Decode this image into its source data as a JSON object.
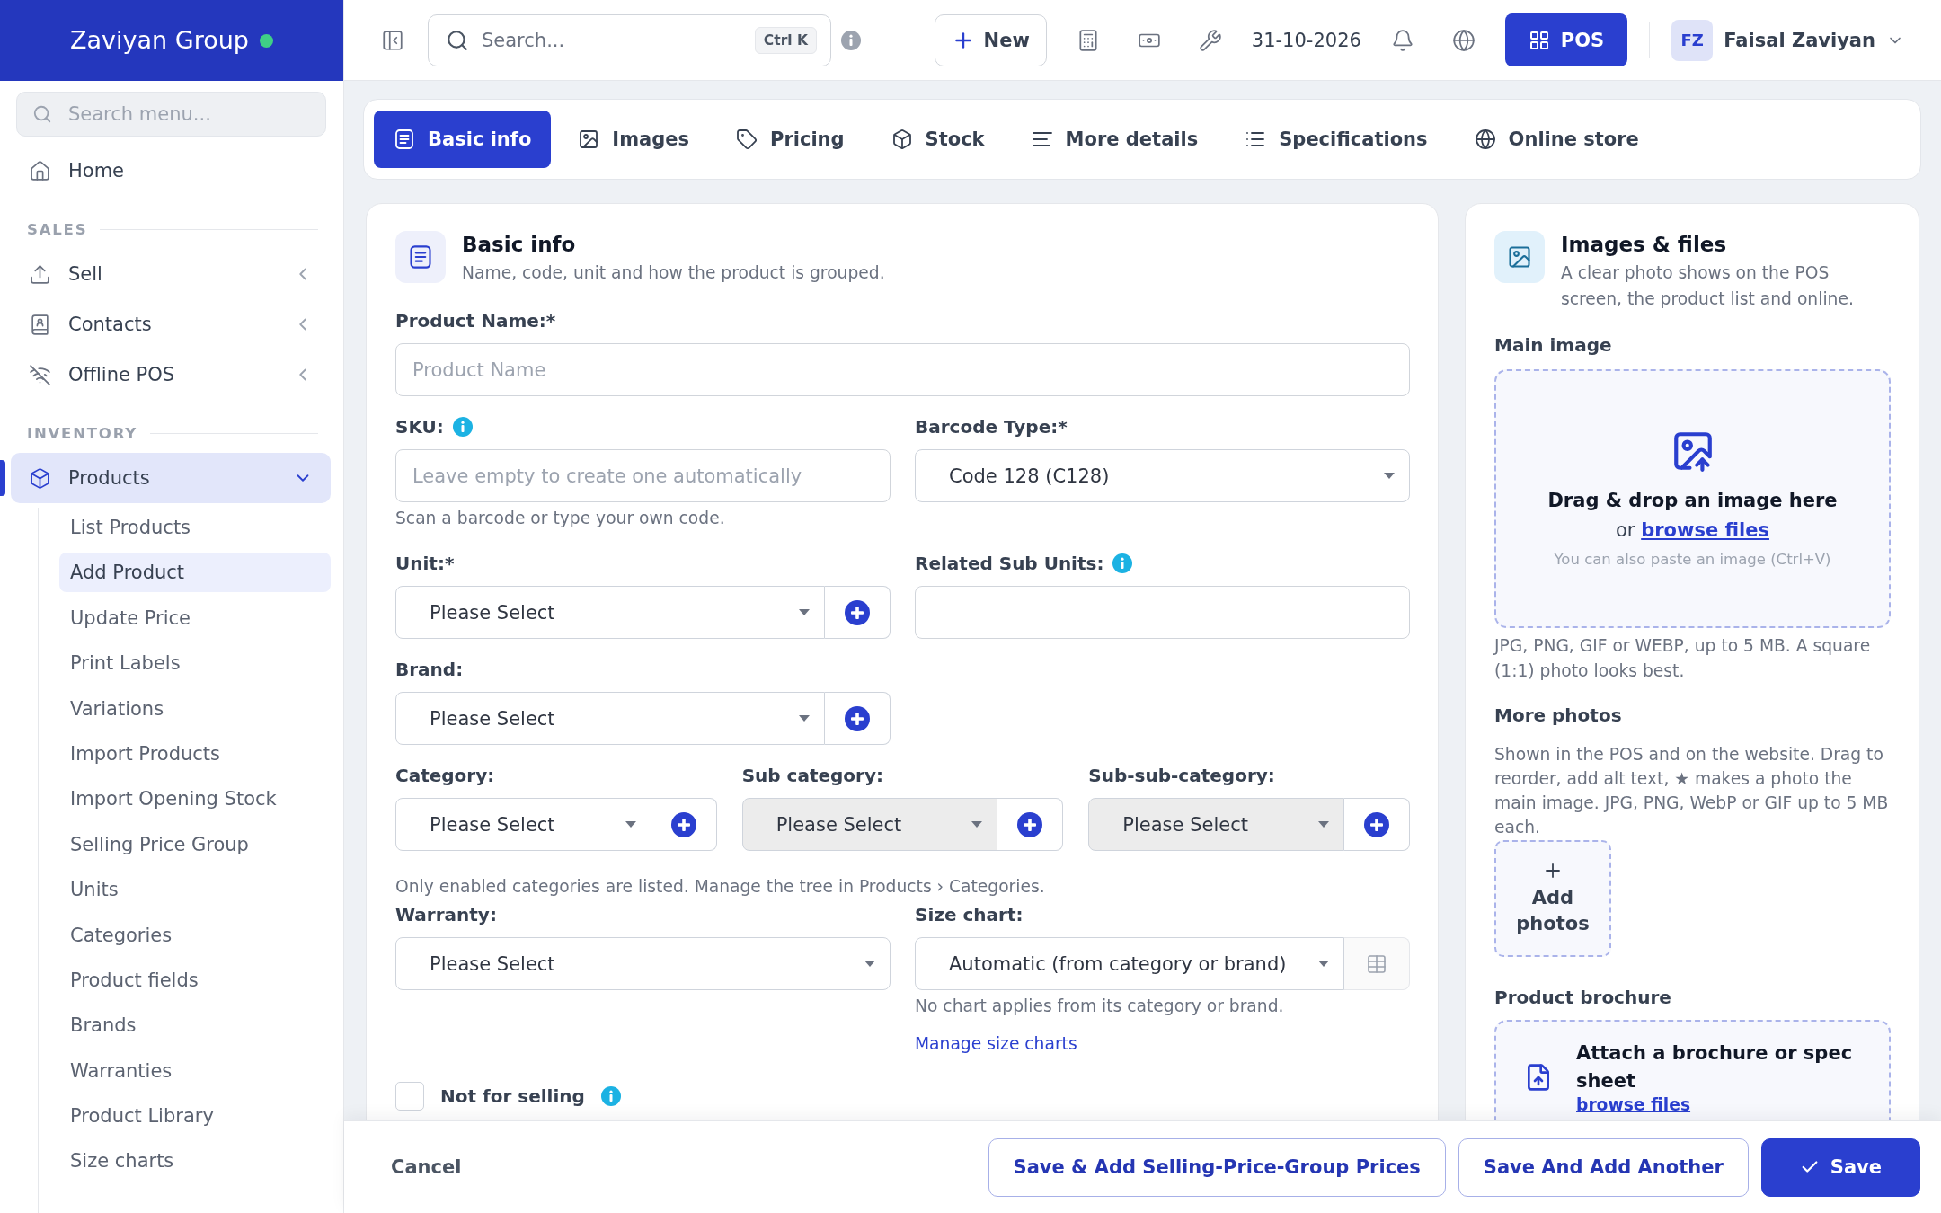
{
  "brand": {
    "name": "Zaviyan Group",
    "online": true
  },
  "topbar": {
    "search": {
      "placeholder": "Search...",
      "shortcut": "Ctrl K"
    },
    "new_button": "New",
    "date": "31-10-2026",
    "pos_button": "POS",
    "user": {
      "initials": "FZ",
      "name": "Faisal Zaviyan"
    }
  },
  "sidebar": {
    "search": {
      "placeholder": "Search menu..."
    },
    "items": [
      {
        "kind": "link",
        "label": "Home",
        "selected": false
      },
      {
        "kind": "heading",
        "label": "SALES"
      },
      {
        "kind": "group",
        "label": "Sell",
        "selected": false,
        "expanded": false
      },
      {
        "kind": "group",
        "label": "Contacts",
        "selected": false,
        "expanded": false
      },
      {
        "kind": "group",
        "label": "Offline POS",
        "selected": false,
        "expanded": false
      },
      {
        "kind": "heading",
        "label": "INVENTORY"
      },
      {
        "kind": "group",
        "label": "Products",
        "selected": true,
        "expanded": true,
        "children": [
          {
            "label": "List Products",
            "selected": false
          },
          {
            "label": "Add Product",
            "selected": true
          },
          {
            "label": "Update Price",
            "selected": false
          },
          {
            "label": "Print Labels",
            "selected": false
          },
          {
            "label": "Variations",
            "selected": false
          },
          {
            "label": "Import Products",
            "selected": false
          },
          {
            "label": "Import Opening Stock",
            "selected": false
          },
          {
            "label": "Selling Price Group",
            "selected": false
          },
          {
            "label": "Units",
            "selected": false
          },
          {
            "label": "Categories",
            "selected": false
          },
          {
            "label": "Product fields",
            "selected": false
          },
          {
            "label": "Brands",
            "selected": false
          },
          {
            "label": "Warranties",
            "selected": false
          },
          {
            "label": "Product Library",
            "selected": false
          },
          {
            "label": "Size charts",
            "selected": false
          }
        ]
      }
    ]
  },
  "tabs": [
    {
      "label": "Basic info",
      "selected": true
    },
    {
      "label": "Images",
      "selected": false
    },
    {
      "label": "Pricing",
      "selected": false
    },
    {
      "label": "Stock",
      "selected": false
    },
    {
      "label": "More details",
      "selected": false
    },
    {
      "label": "Specifications",
      "selected": false
    },
    {
      "label": "Online store",
      "selected": false
    }
  ],
  "basic_info": {
    "title": "Basic info",
    "subtitle": "Name, code, unit and how the product is grouped.",
    "product_name": {
      "label": "Product Name:*",
      "placeholder": "Product Name"
    },
    "sku": {
      "label": "SKU:",
      "info": true,
      "placeholder": "Leave empty to create one automatically",
      "hint": "Scan a barcode or type your own code."
    },
    "barcode_type": {
      "label": "Barcode Type:*",
      "value": "Code 128 (C128)"
    },
    "unit": {
      "label": "Unit:*",
      "value": "Please Select"
    },
    "related_sub_units": {
      "label": "Related Sub Units:",
      "info": true
    },
    "brand": {
      "label": "Brand:",
      "value": "Please Select"
    },
    "categories": [
      {
        "label": "Category:",
        "value": "Please Select",
        "disabled": false
      },
      {
        "label": "Sub category:",
        "value": "Please Select",
        "disabled": true
      },
      {
        "label": "Sub-sub-category:",
        "value": "Please Select",
        "disabled": true
      }
    ],
    "categories_hint": "Only enabled categories are listed. Manage the tree in Products › Categories.",
    "warranty": {
      "label": "Warranty:",
      "value": "Please Select"
    },
    "size_chart": {
      "label": "Size chart:",
      "value": "Automatic (from category or brand)",
      "hint": "No chart applies from its category or brand.",
      "link": "Manage size charts"
    },
    "not_for_selling": {
      "label": "Not for selling",
      "checked": false,
      "info": true
    }
  },
  "images_files": {
    "title": "Images & files",
    "subtitle": "A clear photo shows on the POS screen, the product list and online.",
    "main_image": {
      "label": "Main image",
      "title": "Drag & drop an image here",
      "prompt": "or",
      "link": "browse files",
      "paste_hint": "You can also paste an image (Ctrl+V)",
      "note": "JPG, PNG, GIF or WEBP, up to 5 MB. A square (1:1) photo looks best."
    },
    "more_photos": {
      "label": "More photos",
      "note": "Shown in the POS and on the website. Drag to reorder, add alt text, ★ makes a photo the main image. JPG, PNG, WebP or GIF up to 5 MB each.",
      "add_button": "Add photos"
    },
    "brochure": {
      "label": "Product brochure",
      "title": "Attach a brochure or spec sheet",
      "link": "browse files"
    }
  },
  "footer": {
    "cancel": "Cancel",
    "buttons": [
      {
        "label": "Save & Add Selling-Price-Group Prices",
        "kind": "outline"
      },
      {
        "label": "Save And Add Another",
        "kind": "outline"
      },
      {
        "label": "Save",
        "kind": "primary"
      }
    ]
  }
}
